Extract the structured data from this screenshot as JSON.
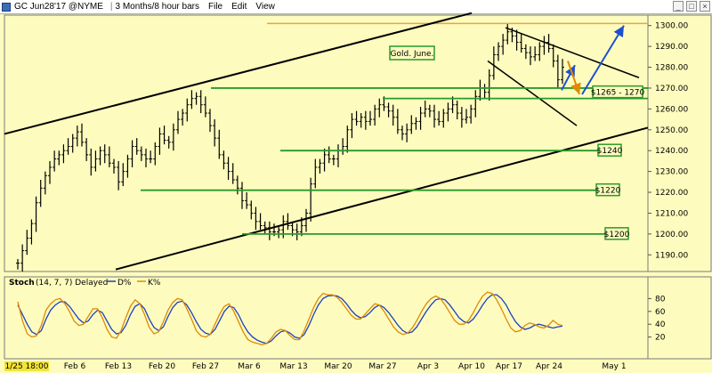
{
  "window": {
    "symbol": "GC Jun28'17 @NYME",
    "period": "3 Months/8 hour bars",
    "menus": [
      "File",
      "Edit",
      "View"
    ]
  },
  "chart_data": [
    {
      "type": "line",
      "title": "Gold. June.",
      "ylim": [
        1182,
        1305
      ],
      "yticks": [
        1190,
        1200,
        1210,
        1220,
        1230,
        1240,
        1250,
        1260,
        1270,
        1280,
        1290,
        1300
      ],
      "x_labels": [
        "1/25 18:00",
        "Feb 6",
        "Feb 13",
        "Feb 20",
        "Feb 27",
        "Mar 6",
        "Mar 13",
        "Mar 20",
        "Mar 27",
        "Apr 3",
        "Apr 10",
        "Apr 17",
        "Apr 24",
        "May 1"
      ],
      "series": [
        {
          "values": [
            1186,
            1192,
            1198,
            1205,
            1215,
            1222,
            1228,
            1232,
            1236,
            1238,
            1240,
            1242,
            1246,
            1249,
            1244,
            1238,
            1232,
            1236,
            1240,
            1238,
            1234,
            1232,
            1225,
            1230,
            1236,
            1242,
            1240,
            1238,
            1236,
            1236,
            1242,
            1248,
            1245,
            1244,
            1250,
            1255,
            1258,
            1262,
            1265,
            1266,
            1262,
            1258,
            1252,
            1246,
            1238,
            1234,
            1230,
            1226,
            1222,
            1216,
            1214,
            1210,
            1206,
            1204,
            1203,
            1201,
            1201,
            1202,
            1206,
            1204,
            1202,
            1201,
            1204,
            1210,
            1224,
            1232,
            1234,
            1238,
            1236,
            1236,
            1240,
            1242,
            1250,
            1255,
            1254,
            1256,
            1254,
            1255,
            1260,
            1262,
            1261,
            1259,
            1256,
            1250,
            1248,
            1250,
            1253,
            1254,
            1258,
            1260,
            1259,
            1255,
            1254,
            1258,
            1260,
            1262,
            1258,
            1255,
            1256,
            1260,
            1266,
            1270,
            1268,
            1276,
            1286,
            1290,
            1293,
            1297,
            1295,
            1292,
            1289,
            1287,
            1285,
            1286,
            1290,
            1292,
            1289,
            1283,
            1274,
            1280
          ]
        }
      ],
      "annotations": [
        "$1265 - 1270",
        "$1240",
        "$1220",
        "$1200"
      ]
    },
    {
      "type": "line",
      "title": "Stoch",
      "indicator_label": "(14, 7, 7) Delayed",
      "ylim": [
        0,
        100
      ],
      "yticks": [
        20,
        40,
        60,
        80
      ],
      "series": [
        {
          "name": "D%",
          "color": "#1f3fbf",
          "values": [
            70,
            55,
            40,
            28,
            24,
            30,
            48,
            62,
            70,
            75,
            75,
            68,
            58,
            48,
            42,
            45,
            55,
            62,
            58,
            45,
            32,
            25,
            27,
            38,
            55,
            68,
            72,
            64,
            48,
            35,
            30,
            36,
            52,
            66,
            74,
            76,
            70,
            58,
            44,
            32,
            26,
            24,
            32,
            46,
            60,
            68,
            66,
            55,
            40,
            28,
            20,
            15,
            12,
            10,
            14,
            22,
            28,
            30,
            26,
            20,
            18,
            24,
            38,
            55,
            70,
            80,
            84,
            85,
            84,
            80,
            72,
            62,
            54,
            50,
            52,
            58,
            66,
            70,
            66,
            58,
            48,
            38,
            30,
            26,
            28,
            36,
            48,
            60,
            70,
            78,
            80,
            78,
            70,
            60,
            50,
            44,
            42,
            48,
            58,
            70,
            80,
            86,
            86,
            80,
            70,
            56,
            44,
            36,
            32,
            34,
            38,
            40,
            38,
            36,
            34,
            36,
            37
          ]
        },
        {
          "name": "K%",
          "color": "#e08a00",
          "values": [
            75,
            45,
            25,
            20,
            22,
            38,
            62,
            72,
            78,
            80,
            72,
            60,
            45,
            38,
            40,
            52,
            64,
            64,
            50,
            32,
            20,
            18,
            30,
            50,
            68,
            78,
            72,
            55,
            35,
            25,
            28,
            44,
            62,
            74,
            80,
            78,
            64,
            48,
            30,
            22,
            20,
            24,
            40,
            56,
            68,
            72,
            60,
            44,
            28,
            16,
            12,
            10,
            8,
            10,
            18,
            28,
            32,
            30,
            22,
            16,
            16,
            30,
            48,
            66,
            80,
            88,
            86,
            86,
            82,
            74,
            64,
            54,
            48,
            48,
            56,
            64,
            72,
            70,
            60,
            48,
            36,
            28,
            24,
            26,
            34,
            46,
            60,
            72,
            80,
            84,
            80,
            70,
            58,
            46,
            40,
            40,
            46,
            58,
            72,
            84,
            90,
            88,
            78,
            64,
            48,
            34,
            28,
            30,
            38,
            42,
            40,
            36,
            34,
            38,
            46,
            40,
            38
          ]
        }
      ]
    }
  ]
}
